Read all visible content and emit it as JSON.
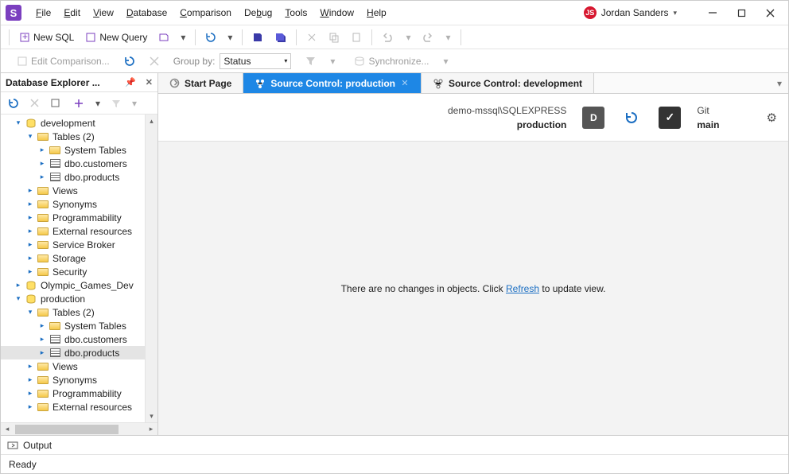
{
  "menu": {
    "file": "File",
    "edit": "Edit",
    "view": "View",
    "database": "Database",
    "comparison": "Comparison",
    "debug": "Debug",
    "tools": "Tools",
    "window": "Window",
    "help": "Help"
  },
  "user": {
    "initials": "JS",
    "name": "Jordan  Sanders"
  },
  "toolbar": {
    "new_sql": "New SQL",
    "new_query": "New Query"
  },
  "toolbar2": {
    "edit_comparison": "Edit Comparison...",
    "group_by_label": "Group by:",
    "group_by_value": "Status",
    "synchronize": "Synchronize..."
  },
  "explorer": {
    "title": "Database Explorer ...",
    "tree": [
      {
        "indent": 1,
        "arrOpen": true,
        "arrBlue": true,
        "iconType": "db",
        "label": "development"
      },
      {
        "indent": 2,
        "arrOpen": true,
        "arrBlue": true,
        "iconType": "folder",
        "label": "Tables (2)"
      },
      {
        "indent": 3,
        "arrOpen": false,
        "arrBlue": true,
        "iconType": "folder",
        "label": "System Tables"
      },
      {
        "indent": 3,
        "arrOpen": false,
        "arrBlue": true,
        "iconType": "table",
        "label": "dbo.customers"
      },
      {
        "indent": 3,
        "arrOpen": false,
        "arrBlue": true,
        "iconType": "table",
        "label": "dbo.products"
      },
      {
        "indent": 2,
        "arrOpen": false,
        "arrBlue": true,
        "iconType": "folder",
        "label": "Views"
      },
      {
        "indent": 2,
        "arrOpen": false,
        "arrBlue": true,
        "iconType": "folder",
        "label": "Synonyms"
      },
      {
        "indent": 2,
        "arrOpen": false,
        "arrBlue": true,
        "iconType": "folder",
        "label": "Programmability"
      },
      {
        "indent": 2,
        "arrOpen": false,
        "arrBlue": true,
        "iconType": "folder",
        "label": "External resources"
      },
      {
        "indent": 2,
        "arrOpen": false,
        "arrBlue": true,
        "iconType": "folder",
        "label": "Service Broker"
      },
      {
        "indent": 2,
        "arrOpen": false,
        "arrBlue": true,
        "iconType": "folder",
        "label": "Storage"
      },
      {
        "indent": 2,
        "arrOpen": false,
        "arrBlue": true,
        "iconType": "folder",
        "label": "Security"
      },
      {
        "indent": 1,
        "arrOpen": false,
        "arrBlue": true,
        "iconType": "db",
        "label": "Olympic_Games_Dev"
      },
      {
        "indent": 1,
        "arrOpen": true,
        "arrBlue": true,
        "iconType": "db",
        "label": "production"
      },
      {
        "indent": 2,
        "arrOpen": true,
        "arrBlue": true,
        "iconType": "folder",
        "label": "Tables (2)"
      },
      {
        "indent": 3,
        "arrOpen": false,
        "arrBlue": true,
        "iconType": "folder",
        "label": "System Tables"
      },
      {
        "indent": 3,
        "arrOpen": false,
        "arrBlue": true,
        "iconType": "table",
        "label": "dbo.customers"
      },
      {
        "indent": 3,
        "arrOpen": false,
        "arrBlue": true,
        "iconType": "table",
        "label": "dbo.products",
        "selected": true
      },
      {
        "indent": 2,
        "arrOpen": false,
        "arrBlue": true,
        "iconType": "folder",
        "label": "Views"
      },
      {
        "indent": 2,
        "arrOpen": false,
        "arrBlue": true,
        "iconType": "folder",
        "label": "Synonyms"
      },
      {
        "indent": 2,
        "arrOpen": false,
        "arrBlue": true,
        "iconType": "folder",
        "label": "Programmability"
      },
      {
        "indent": 2,
        "arrOpen": false,
        "arrBlue": true,
        "iconType": "folder",
        "label": "External resources"
      }
    ]
  },
  "tabs": {
    "start": "Start Page",
    "sc_prod": "Source Control: production",
    "sc_dev": "Source Control: development"
  },
  "source_control": {
    "server": "demo-mssql\\SQLEXPRESS",
    "db": "production",
    "db_letter": "D",
    "vcs": "Git",
    "branch": "main",
    "no_changes_pre": "There are no changes in objects. Click ",
    "no_changes_link": "Refresh",
    "no_changes_post": " to update view."
  },
  "bottom": {
    "output": "Output"
  },
  "status": {
    "text": "Ready"
  }
}
